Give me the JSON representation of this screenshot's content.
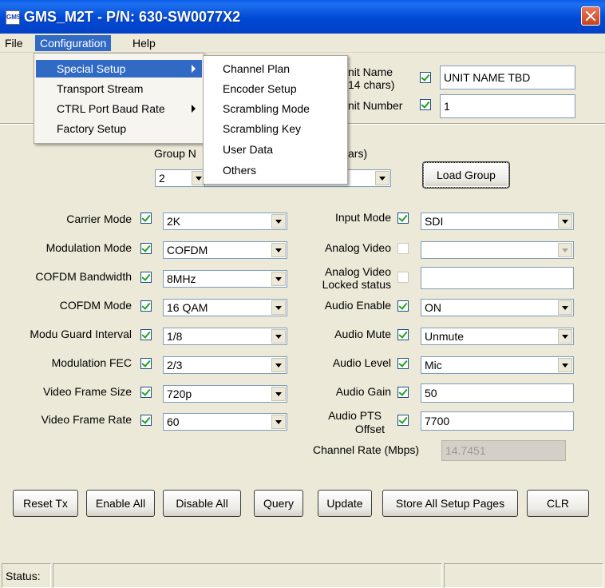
{
  "window": {
    "title": "GMS_M2T - P/N: 630-SW0077X2",
    "icon_text": "GMS"
  },
  "menubar": {
    "file": "File",
    "configuration": "Configuration",
    "help": "Help"
  },
  "config_menu": {
    "items": [
      {
        "label": "Special Setup",
        "has_submenu": true
      },
      {
        "label": "Transport Stream",
        "has_submenu": false
      },
      {
        "label": "CTRL Port Baud Rate",
        "has_submenu": true
      },
      {
        "label": "Factory Setup",
        "has_submenu": false
      }
    ]
  },
  "special_setup_menu": {
    "items": [
      "Channel Plan",
      "Encoder Setup",
      "Scrambling Mode",
      "Scrambling Key",
      "User Data",
      "Others"
    ]
  },
  "unit": {
    "name_label_line1": "nit Name",
    "name_label_line2": "14 chars)",
    "name_checked": true,
    "name_value": "UNIT NAME TBD",
    "number_label": "nit Number",
    "number_checked": true,
    "number_value": "1"
  },
  "group": {
    "label_left": "Group N",
    "label_right": "ars)",
    "selected": "2",
    "load_button": "Load Group"
  },
  "left_fields": [
    {
      "label": "Carrier Mode",
      "checked": true,
      "value": "2K"
    },
    {
      "label": "Modulation Mode",
      "checked": true,
      "value": "COFDM"
    },
    {
      "label": "COFDM Bandwidth",
      "checked": true,
      "value": "8MHz"
    },
    {
      "label": "COFDM Mode",
      "checked": true,
      "value": "16 QAM"
    },
    {
      "label": "Modu Guard Interval",
      "checked": true,
      "value": "1/8"
    },
    {
      "label": "Modulation FEC",
      "checked": true,
      "value": "2/3"
    },
    {
      "label": "Video Frame Size",
      "checked": true,
      "value": "720p"
    },
    {
      "label": "Video Frame Rate",
      "checked": true,
      "value": "60"
    }
  ],
  "right_fields": {
    "input_mode": {
      "label": "Input Mode",
      "checked": true,
      "value": "SDI"
    },
    "analog_video": {
      "label": "Analog Video",
      "checked": false,
      "value": ""
    },
    "analog_locked": {
      "label_line1": "Analog Video",
      "label_line2": "Locked status",
      "checked": false,
      "value": ""
    },
    "audio_enable": {
      "label": "Audio Enable",
      "checked": true,
      "value": "ON"
    },
    "audio_mute": {
      "label": "Audio Mute",
      "checked": true,
      "value": "Unmute"
    },
    "audio_level": {
      "label": "Audio Level",
      "checked": true,
      "value": "Mic"
    },
    "audio_gain": {
      "label": "Audio Gain",
      "checked": true,
      "value": "50"
    },
    "audio_pts": {
      "label_line1": "Audio PTS",
      "label_line2": "Offset",
      "checked": true,
      "value": "7700"
    },
    "channel_rate": {
      "label": "Channel Rate (Mbps)",
      "value": "14.7451"
    }
  },
  "buttons": {
    "reset_tx": "Reset Tx",
    "enable_all": "Enable All",
    "disable_all": "Disable All",
    "query": "Query",
    "update": "Update",
    "store_all": "Store All Setup Pages",
    "clr": "CLR"
  },
  "status": {
    "label": "Status:",
    "message": "",
    "extra": ""
  },
  "colors": {
    "titlebar": "#0049D5",
    "menu_highlight": "#316AC5",
    "face": "#ECE9D8",
    "check_green": "#21A121"
  }
}
